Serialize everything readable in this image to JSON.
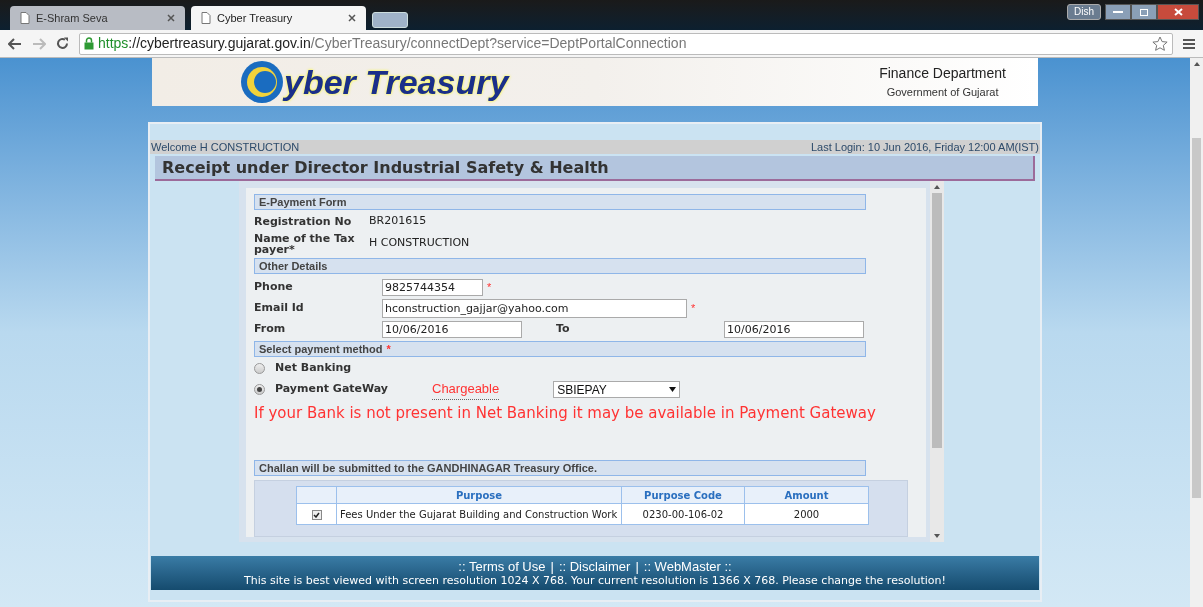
{
  "browser": {
    "tabs": [
      {
        "label": "E-Shram Seva",
        "selected": false
      },
      {
        "label": "Cyber Treasury",
        "selected": true
      }
    ],
    "profile": "Dish",
    "url": {
      "scheme": "https",
      "host": "://cybertreasury.gujarat.gov.in",
      "path": "/CyberTreasury/connectDept?service=DeptPortalConnection"
    }
  },
  "header": {
    "logo_text": "yber Treasury",
    "department": "Finance Department",
    "government": "Government of Gujarat"
  },
  "welcome": "Welcome H CONSTRUCTION",
  "last_login": "Last Login: 10 Jun 2016, Friday 12:00 AM(IST)",
  "page_title": "Receipt under Director Industrial Safety & Health",
  "form": {
    "section_title": "E-Payment Form",
    "info_rows": [
      {
        "label": "Registration No",
        "value": "BR201615"
      },
      {
        "label": "Name of the Tax payer*",
        "value": "H CONSTRUCTION"
      }
    ],
    "other_title": "Other Details",
    "phone": {
      "label": "Phone",
      "value": "9825744354",
      "required": "*"
    },
    "email": {
      "label": "Email Id",
      "value": "hconstruction_gajjar@yahoo.com",
      "required": "*"
    },
    "from": {
      "label": "From",
      "value": "10/06/2016"
    },
    "to": {
      "label": "To",
      "value": "10/06/2016"
    },
    "payment_title": "Select payment method",
    "payment_required": "*",
    "methods": [
      {
        "label": "Net Banking",
        "selected": false
      },
      {
        "label": "Payment GateWay",
        "selected": true
      }
    ],
    "chargeable": "Chargeable",
    "gateway": "SBIEPAY",
    "notice": "If your Bank is not present in Net Banking it may be available in Payment Gateway",
    "challan": "Challan will be submitted to the GANDHINAGAR Treasury Office.",
    "table": {
      "columns": [
        "Purpose",
        "Purpose Code",
        "Amount"
      ],
      "rows": [
        {
          "checked": true,
          "purpose": "Fees Under the Gujarat Building and Construction Work",
          "code": "0230-00-106-02",
          "amount": "2000"
        }
      ]
    }
  },
  "footer": {
    "links": [
      ":: Terms of Use",
      ":: Disclaimer",
      ":: WebMaster ::"
    ],
    "separator": "|",
    "note": "This site is best viewed with screen resolution 1024 X 768. Your current resolution is 1366 X 768. Please change the resolution!"
  }
}
